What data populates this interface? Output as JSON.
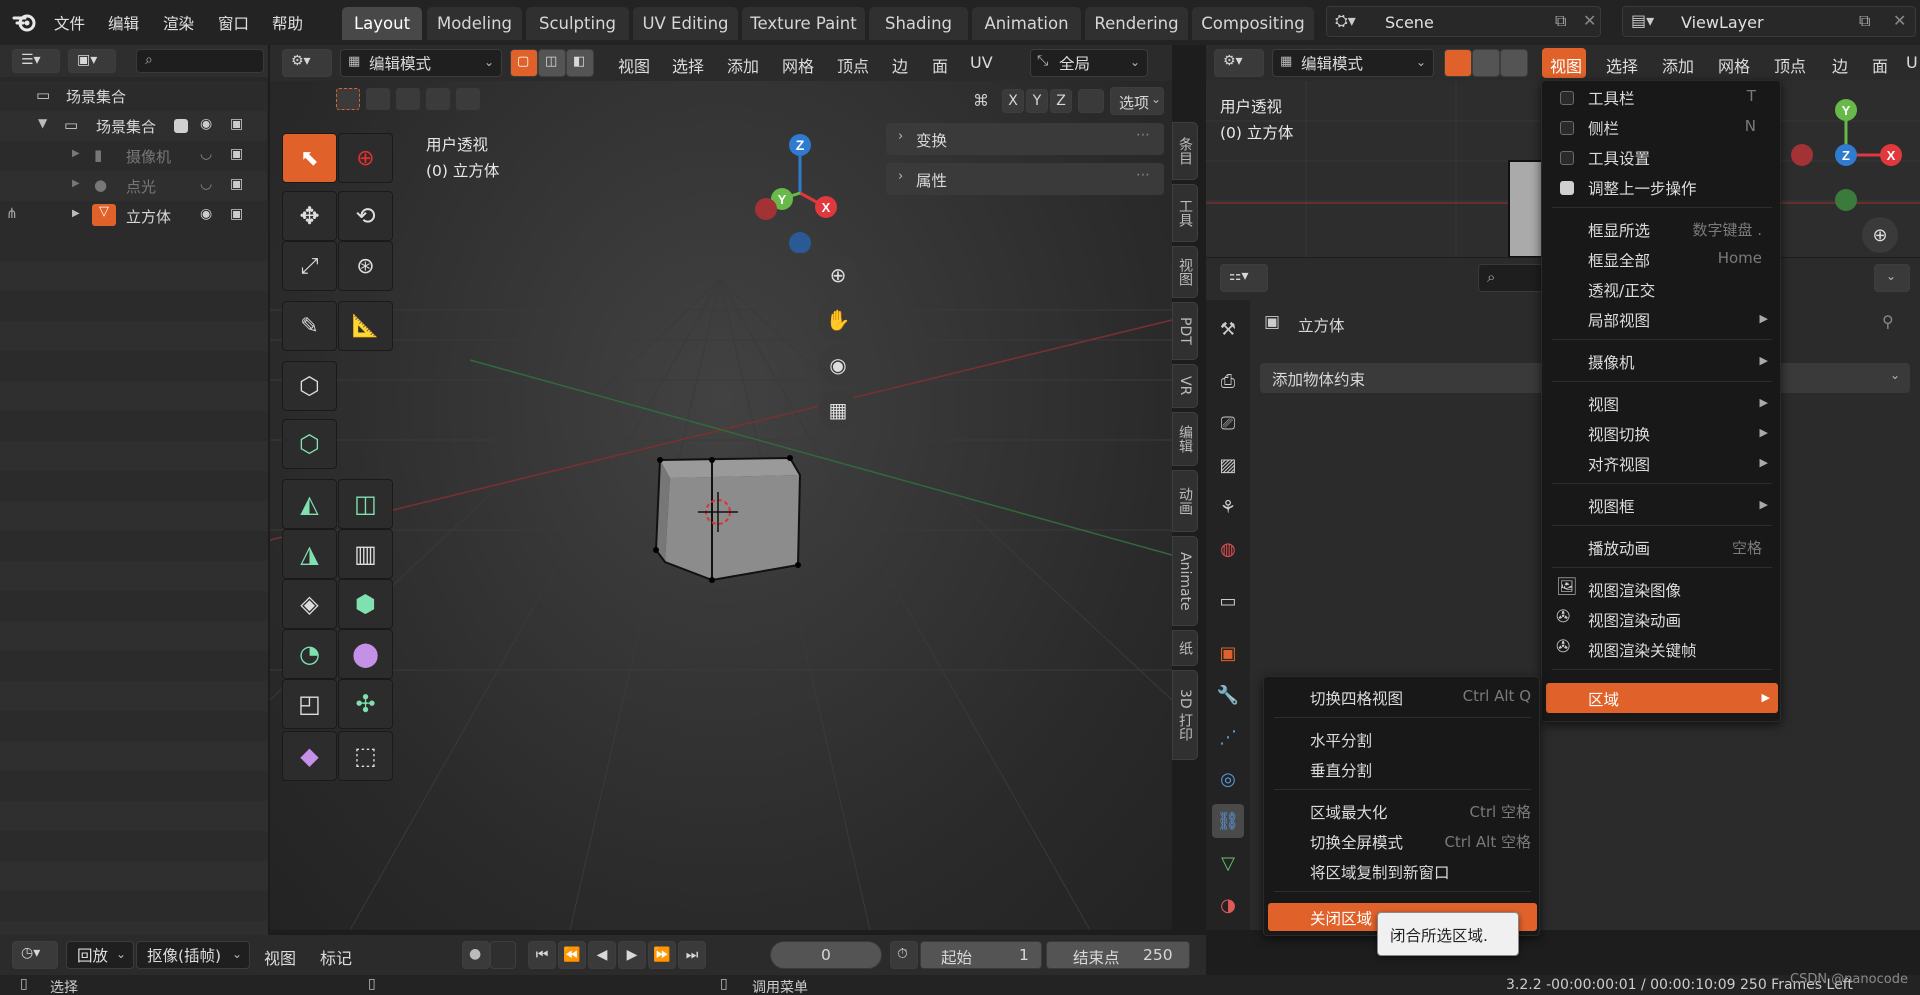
{
  "topbar": {
    "menus": [
      "文件",
      "编辑",
      "渲染",
      "窗口",
      "帮助"
    ],
    "workspaces": [
      "Layout",
      "Modeling",
      "Sculpting",
      "UV Editing",
      "Texture Paint",
      "Shading",
      "Animation",
      "Rendering",
      "Compositing"
    ],
    "active_workspace": "Layout",
    "scene": "Scene",
    "view_layer": "ViewLayer"
  },
  "outliner": {
    "items": [
      {
        "label": "场景集合"
      },
      {
        "label": "场景集合"
      },
      {
        "label": "摄像机"
      },
      {
        "label": "点光"
      },
      {
        "label": "立方体"
      }
    ]
  },
  "viewport_left": {
    "mode": "编辑模式",
    "menus": [
      "视图",
      "选择",
      "添加",
      "网格",
      "顶点",
      "边",
      "面",
      "UV"
    ],
    "orientation": "全局",
    "options": "选项",
    "axes": [
      "X",
      "Y",
      "Z"
    ],
    "overlay_line1": "用户透视",
    "overlay_line2": "(0) 立方体",
    "npanel": {
      "transform": "变换",
      "properties": "属性"
    },
    "side_tabs": [
      "条目",
      "工具",
      "视图",
      "PDT",
      "VR",
      "编辑",
      "动画",
      "Animate",
      "纸",
      "3D 打印"
    ],
    "gizmo": {
      "z": "Z",
      "y": "Y",
      "x": "X"
    }
  },
  "viewport_right": {
    "mode": "编辑模式",
    "menus": [
      "视图",
      "选择",
      "添加",
      "网格",
      "顶点",
      "边",
      "面",
      "U"
    ],
    "overlay_line1": "用户透视",
    "overlay_line2": "(0) 立方体",
    "gizmo": {
      "y": "Y",
      "z": "Z",
      "x": "X"
    }
  },
  "properties": {
    "object_name": "立方体",
    "constraint_dropdown": "添加物体约束"
  },
  "view_menu": {
    "items": [
      {
        "label": "工具栏",
        "shortcut": "T",
        "checkbox": false
      },
      {
        "label": "侧栏",
        "shortcut": "N",
        "checkbox": false
      },
      {
        "label": "工具设置",
        "shortcut": "",
        "checkbox": false
      },
      {
        "label": "调整上一步操作",
        "shortcut": "",
        "checkbox": true
      },
      {
        "label": "框显所选",
        "shortcut": "数字键盘 ."
      },
      {
        "label": "框显全部",
        "shortcut": "Home"
      },
      {
        "label": "透视/正交",
        "shortcut": ""
      },
      {
        "label": "局部视图",
        "submenu": true
      },
      {
        "label": "摄像机",
        "submenu": true
      },
      {
        "label": "视图",
        "submenu": true
      },
      {
        "label": "视图切换",
        "submenu": true
      },
      {
        "label": "对齐视图",
        "submenu": true
      },
      {
        "label": "视图框",
        "submenu": true
      },
      {
        "label": "播放动画",
        "shortcut": "空格"
      },
      {
        "label": "视图渲染图像"
      },
      {
        "label": "视图渲染动画"
      },
      {
        "label": "视图渲染关键帧"
      },
      {
        "label": "区域",
        "submenu": true,
        "highlighted": true
      }
    ]
  },
  "area_menu": {
    "items": [
      {
        "label": "切换四格视图",
        "shortcut": "Ctrl Alt Q"
      },
      {
        "label": "水平分割",
        "shortcut": ""
      },
      {
        "label": "垂直分割",
        "shortcut": ""
      },
      {
        "label": "区域最大化",
        "shortcut": "Ctrl 空格"
      },
      {
        "label": "切换全屏模式",
        "shortcut": "Ctrl Alt 空格"
      },
      {
        "label": "将区域复制到新窗口",
        "shortcut": ""
      },
      {
        "label": "关闭区域",
        "shortcut": "",
        "highlighted": true
      }
    ],
    "tooltip": "闭合所选区域."
  },
  "timeline": {
    "playback": "回放",
    "keying": "抠像(插帧)",
    "view": "视图",
    "marker": "标记",
    "current_frame": "0",
    "start_label": "起始",
    "start": "1",
    "end_label": "结束点",
    "end": "250"
  },
  "statusbar": {
    "left": "选择",
    "mid": "调用菜单",
    "right": "3.2.2 -00:00:00:01 / 00:00:10:09  250 Frames Left"
  },
  "watermark": "CSDN @nanocode",
  "colors": {
    "accent": "#e0622a",
    "axis_x": "#e0383d",
    "axis_y": "#68b94a",
    "axis_z": "#2f7bd0",
    "highlight": "#e0622a"
  }
}
